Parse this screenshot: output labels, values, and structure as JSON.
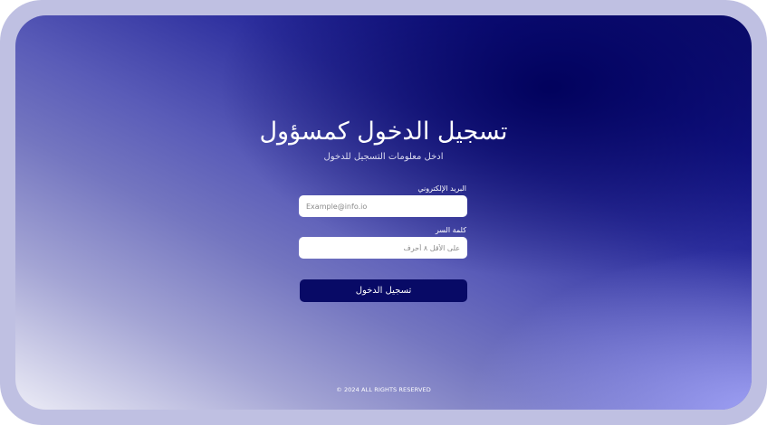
{
  "login": {
    "title": "تسجيل الدخول كمسؤول",
    "subtitle": "ادخل معلومات التسجيل للدخول",
    "email": {
      "label": "البريد الإلكتروني",
      "placeholder": "Example@info.io"
    },
    "password": {
      "label": "كلمة السر",
      "placeholder": "على الأقل ٨ أحرف"
    },
    "submit_label": "تسجيل الدخول"
  },
  "footer": {
    "copyright": "© 2024 ALL RIGHTS RESERVED"
  },
  "colors": {
    "frame": "#bfc0e2",
    "gradient_dark": "#0e0f6f",
    "button": "#080a66",
    "input_bg": "#ffffff"
  }
}
